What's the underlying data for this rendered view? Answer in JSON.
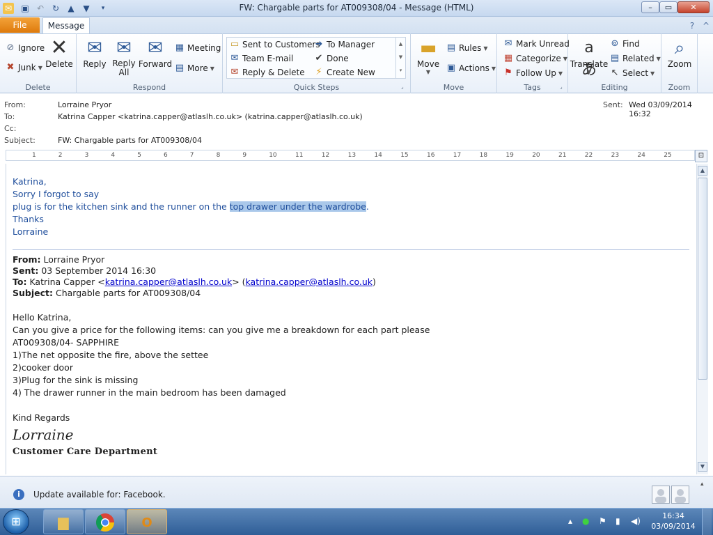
{
  "window": {
    "title": "FW: Chargable parts for AT009308/04  -  Message (HTML)",
    "minimize": "–",
    "maximize": "▭",
    "close": "✕"
  },
  "tabs": {
    "file": "File",
    "message": "Message"
  },
  "ribbon": {
    "delete_group": {
      "ignore": "Ignore",
      "junk": "Junk",
      "delete": "Delete",
      "label": "Delete"
    },
    "respond_group": {
      "reply": "Reply",
      "reply_all": "Reply All",
      "forward": "Forward",
      "meeting": "Meeting",
      "more": "More",
      "label": "Respond"
    },
    "quick_steps": {
      "items": [
        "Sent to Customers",
        "Team E-mail",
        "Reply & Delete",
        "To Manager",
        "Done",
        "Create New"
      ],
      "label": "Quick Steps"
    },
    "move_group": {
      "move": "Move",
      "rules": "Rules",
      "actions": "Actions",
      "label": "Move"
    },
    "tags_group": {
      "mark_unread": "Mark Unread",
      "categorize": "Categorize",
      "follow_up": "Follow Up",
      "label": "Tags"
    },
    "editing_group": {
      "translate": "Translate",
      "find": "Find",
      "related": "Related",
      "select": "Select",
      "label": "Editing"
    },
    "zoom_group": {
      "zoom": "Zoom",
      "label": "Zoom"
    }
  },
  "headers": {
    "from_label": "From:",
    "from": "Lorraine Pryor",
    "to_label": "To:",
    "to": "Katrina Capper <katrina.capper@atlaslh.co.uk> (katrina.capper@atlaslh.co.uk)",
    "cc_label": "Cc:",
    "subject_label": "Subject:",
    "subject": "FW: Chargable parts for AT009308/04",
    "sent_label": "Sent:",
    "sent": "Wed 03/09/2014 16:32"
  },
  "ruler": {
    "ticks": [
      "1",
      "2",
      "3",
      "4",
      "5",
      "6",
      "7",
      "8",
      "9",
      "10",
      "11",
      "12",
      "13",
      "14",
      "15",
      "16",
      "17",
      "18",
      "19",
      "20",
      "21",
      "22",
      "23",
      "24",
      "25"
    ]
  },
  "body": {
    "reply": {
      "greeting": "Katrina,",
      "line1": "Sorry I forgot to say",
      "line2_start": "plug is for the kitchen sink and the runner on the ",
      "line2_selected": "top drawer under the wardrobe",
      "line2_end": ".",
      "thanks": "Thanks",
      "name": "Lorraine"
    },
    "forwarded": {
      "from_label": "From:",
      "from": "Lorraine Pryor",
      "sent_label": "Sent:",
      "sent": "03 September 2014 16:30",
      "to_label": "To:",
      "to_name": "Katrina Capper <",
      "to_email": "katrina.capper@atlaslh.co.uk",
      "to_mid": "> (",
      "to_email2": "katrina.capper@atlaslh.co.uk",
      "to_end": ")",
      "subject_label": "Subject:",
      "subject": "Chargable parts for AT009308/04"
    },
    "original": {
      "greeting": "Hello Katrina,",
      "intro": "Can you give a price for the following items: can you give me a breakdown for each part please",
      "ref": "AT009308/04- SAPPHIRE",
      "items": [
        "1)The net opposite the fire, above the settee",
        "2)cooker door",
        "3)Plug for the sink is missing",
        "4) The drawer runner in the main bedroom has been damaged"
      ],
      "regards": "Kind Regards",
      "signature": "Lorraine",
      "department": "Customer Care Department"
    }
  },
  "infobar": {
    "message": "Update available for: Facebook."
  },
  "taskbar": {
    "time": "16:34",
    "date": "03/09/2014"
  }
}
